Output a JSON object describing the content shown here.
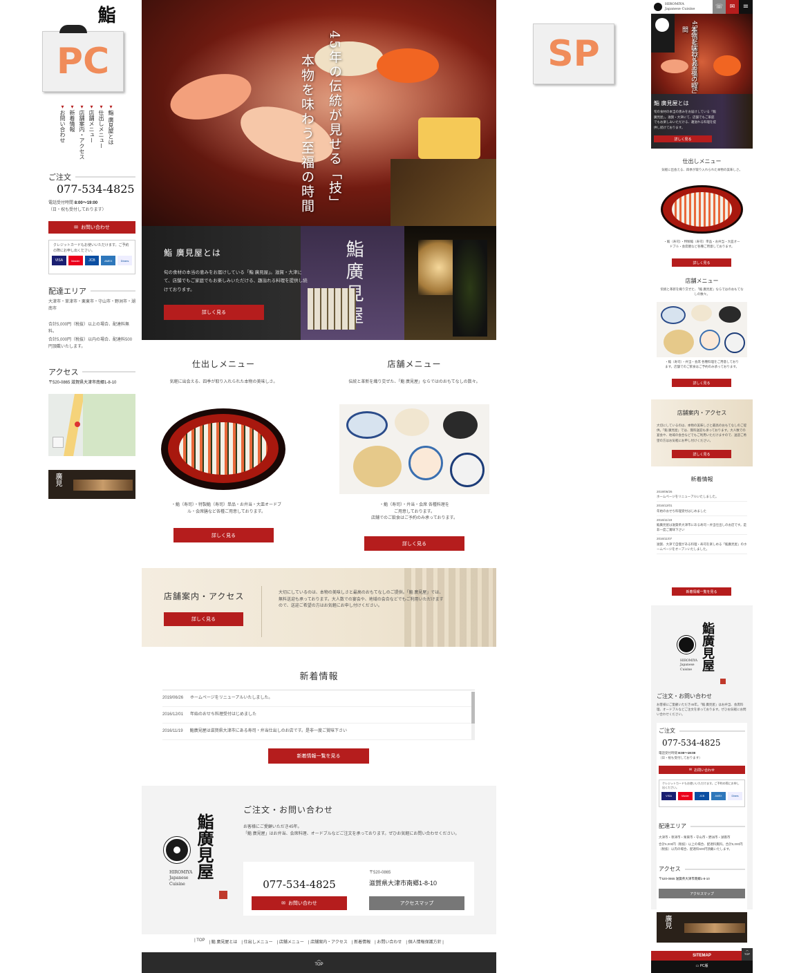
{
  "labels": {
    "pc": "PC",
    "sp": "SP"
  },
  "pc": {
    "sidebar": {
      "nav": [
        "鮨 廣見屋とは",
        "仕出しメニュー",
        "店舗メニュー",
        "店舗案内・アクセス",
        "新着情報",
        "お問い合わせ"
      ],
      "order_title": "ご注文",
      "phone": "077-534-4825",
      "hours_label": "電話受付時間",
      "hours": "8:00〜19:00",
      "hours_note": "（日・祝も受付しております）",
      "contact_btn": "お問い合わせ",
      "card_note": "クレジットカードもお使いいただけます。ご予約の際にお申し出ください。",
      "cards": [
        "VISA",
        "Master",
        "JCB",
        "AMEX",
        "Diners"
      ],
      "delivery_title": "配達エリア",
      "delivery_areas": "大津市・草津市・栗東市・守山市・野洲市・湖南市",
      "delivery_note1": "合計5,000円（税抜）以上の場合、配達料無料。",
      "delivery_note2": "合計5,000円（税抜）以内の場合、配達料500円頂戴いたします。",
      "access_title": "アクセス",
      "address": "〒520-0865 滋賀県大津市南郷1-8-10"
    },
    "hero": {
      "line1": "45年の伝統が見せる「技」",
      "line2": "本物を味わう至福の時間"
    },
    "about": {
      "title": "鮨 廣見屋とは",
      "text": "旬の食材の本当の恵みをお届けしている「鮨 廣見屋」。滋賀・大津にて、店舗でもご家庭でもお楽しみいただける、趣溢れる料理を提供し続けております。",
      "btn": "詳しく見る",
      "noren": "鮨廣見屋"
    },
    "menu1": {
      "title": "仕出しメニュー",
      "lead": "気軽に出会える、四季が取り入れられた本物の美味しさ。",
      "desc": "・鮨（寿司）・特製鮨（寿司）単品・お弁当・大皿オードブル・会席膳など各種ご用意しております。",
      "btn": "詳しく見る"
    },
    "menu2": {
      "title": "店舗メニュー",
      "lead": "伝統と革新を織り交ぜた、「鮨 廣見屋」ならではのおもてなしの数々。",
      "desc1": "・鮨（寿司）・弁当・会席 各種料理を",
      "desc2": "ご用意しております。",
      "desc3": "店舗でのご飲食はご予約のみ承っております。",
      "btn": "詳しく見る"
    },
    "access_band": {
      "title": "店舗案内・アクセス",
      "btn": "詳しく見る",
      "text": "大切にしているのは、本物の美味しさと最高のおもてなしのご提供。「鮨 廣見屋」では、無料送迎も承っております。大人数での宴会や、地域の会合などでもご利用いただけますので、送迎ご希望の方はお気軽にお申し付けください。"
    },
    "news": {
      "title": "新着情報",
      "items": [
        {
          "date": "2019/06/26",
          "text": "ホームページをリニューアルいたしました。"
        },
        {
          "date": "2016/12/01",
          "text": "年始のおせち料理受付はじめました"
        },
        {
          "date": "2016/11/19",
          "text": "鮨廣見屋は滋賀県大津市にある寿司・弁当仕出しのお店です。是非一度ご賞味下さい"
        }
      ],
      "btn": "新着情報一覧を見る"
    },
    "contact": {
      "title": "ご注文・お問い合わせ",
      "text1": "お客様にご愛顧いただき45年。",
      "text2": "「鮨 廣見屋」はお弁当、会席料理、オードブルなどご注文を承っております。ぜひお気軽にお問い合わせください。",
      "phone": "077-534-4825",
      "contact_btn": "お問い合わせ",
      "zip": "〒520-0865",
      "address": "滋賀県大津市南郷1-8-10",
      "map_btn": "アクセスマップ",
      "logo_kanji": "鮨廣見屋",
      "logo_en1": "HIROMIYA",
      "logo_en2": "Japanese",
      "logo_en3": "Cuisine"
    },
    "footer_links": [
      "TOP",
      "鮨 廣見屋とは",
      "仕出しメニュー",
      "店舗メニュー",
      "店舗案内・アクセス",
      "新着情報",
      "お問い合わせ",
      "個人情報保護方針"
    ],
    "top_label": "TOP"
  },
  "sp": {
    "header_brand1": "HIROMIYA",
    "header_brand2": "Japanese Cuisine",
    "hero_line1": "45年の伝統が見せる「技」",
    "hero_line2": "本物を味わう至福の時間",
    "about_title": "鮨 廣見屋とは",
    "about_text": "旬の食材の本当の恵みをお届けしている「鮨 廣見屋」。滋賀・大津にて、店舗でもご家庭でもお楽しみいただける、趣溢れる料理を提供し続けております。",
    "about_btn": "詳しく見る",
    "menu1_title": "仕出しメニュー",
    "menu1_lead": "気軽に出会える、四季が取り入れられた本物の美味しさ。",
    "menu1_desc": "・鮨（寿司）・特製鮨（寿司）単品・お弁当・大皿オードブル・会席膳など各種ご用意しております。",
    "menu1_btn": "詳しく見る",
    "menu2_title": "店舗メニュー",
    "menu2_lead": "伝統と革新を織り交ぜた、「鮨 廣見屋」ならではのおもてなしの数々。",
    "menu2_desc": "・鮨（寿司）・弁当・会席 各種料理をご用意しております。店舗でのご飲食はご予約のみ承っております。",
    "menu2_btn": "詳しく見る",
    "access_title": "店舗案内・アクセス",
    "access_text": "大切にしているのは、本物の美味しさと最高のおもてなしのご提供。「鮨 廣見屋」では、無料送迎も承っております。大人数での宴会や、地域の会合などでもご利用いただけますので、送迎ご希望の方はお気軽にお申し付けください。",
    "access_btn": "詳しく見る",
    "news_title": "新着情報",
    "news": [
      {
        "date": "2019/06/26",
        "text": "ホームページをリニューアルいたしました。"
      },
      {
        "date": "2016/12/01",
        "text": "年始のおせち料理受付はじめました"
      },
      {
        "date": "2016/11/19",
        "text": "鮨廣見屋は滋賀県大津市にある寿司・弁当仕出しのお店です。是非一度ご賞味下さい"
      },
      {
        "date": "2016/11/07",
        "text": "滋賀、大津で自慢がある料理・寿司を楽しめる「鮨廣見屋」のホームページをオープンいたしました。"
      }
    ],
    "news_btn": "新着情報一覧を見る",
    "logo_kanji": "鮨廣見屋",
    "logo_en1": "HIROMIYA",
    "logo_en2": "Japanese",
    "logo_en3": "Cuisine",
    "contact_title": "ご注文・お問い合わせ",
    "contact_text": "お客様にご愛顧いただき45年。「鮨 廣見屋」はお弁当、会席料理、オードブルなどご注文を承っております。ぜひお気軽にお問い合わせください。",
    "order_title": "ご注文",
    "phone": "077-534-4825",
    "hours_label": "電話受付時間",
    "hours": "8:00〜19:00",
    "hours_note": "（日・祝も受付しております）",
    "contact_btn": "お問い合わせ",
    "card_note": "クレジットカードもお使いいただけます。ご予約の際にお申し出ください。",
    "cards": [
      "VISA",
      "Master",
      "JCB",
      "AMEX",
      "Diners"
    ],
    "delivery_title": "配達エリア",
    "delivery_areas": "大津市・草津市・栗東市・守山市・野洲市・湖南市",
    "delivery_note": "合計5,000円（税抜）以上の場合、配達料無料。合計5,000円（税抜）以内の場合、配達料500円頂戴いたします。",
    "access_sub_title": "アクセス",
    "address": "〒520-0865 滋賀県大津市南郷1-8-10",
    "map_btn": "アクセスマップ",
    "sitemap": "SITEMAP",
    "pc_link": "PC版",
    "top_label": "TOP"
  },
  "colors": {
    "accent": "#b51d1d",
    "dark": "#222222",
    "label": "#f08c5a"
  }
}
